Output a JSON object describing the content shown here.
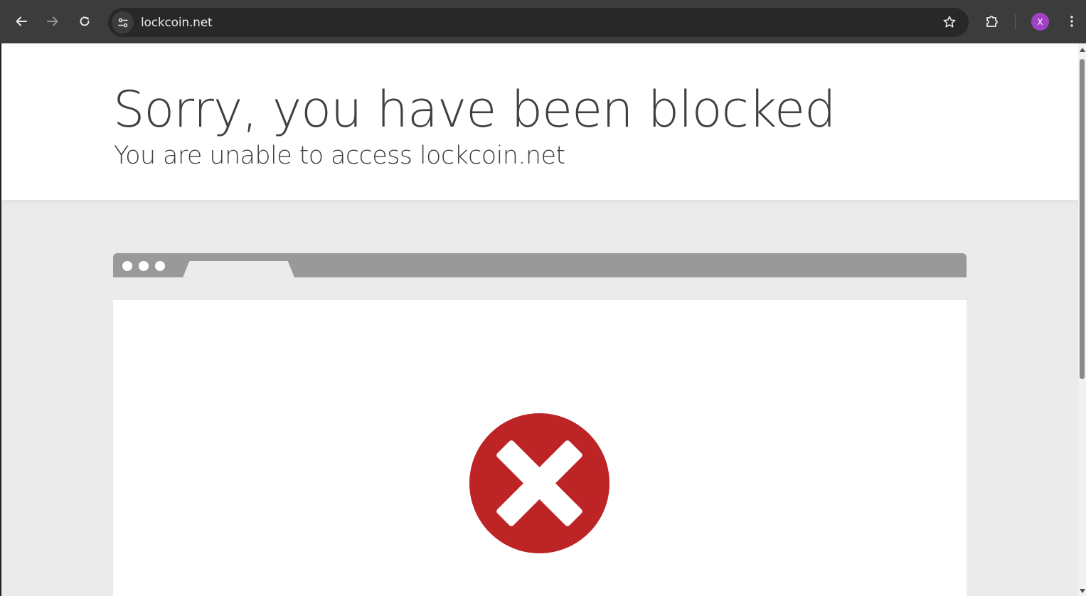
{
  "browser": {
    "url": "lockcoin.net",
    "profile_initial": "X",
    "icons": {
      "back": "arrow-left-icon",
      "forward": "arrow-right-icon",
      "reload": "reload-icon",
      "site_info": "tune-icon",
      "bookmark": "star-icon",
      "extensions": "puzzle-icon",
      "menu": "kebab-menu-icon"
    },
    "colors": {
      "toolbar": "#3c3c3c",
      "omnibox": "#282828",
      "avatar": "#a142c4"
    }
  },
  "page": {
    "headline": "Sorry, you have been blocked",
    "subheadline": "You are unable to access lockcoin.net",
    "error_icon": "error-x-circle-icon",
    "colors": {
      "error": "#bd2426",
      "illustration_bar": "#999999",
      "background": "#ebebeb"
    }
  }
}
